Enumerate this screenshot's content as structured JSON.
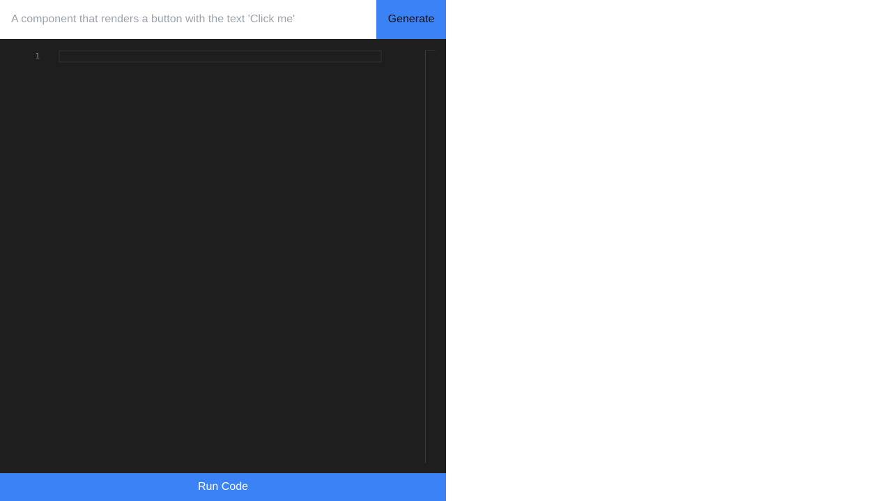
{
  "prompt": {
    "value": "",
    "placeholder": "A component that renders a button with the text 'Click me'",
    "generate_label": "Generate"
  },
  "editor": {
    "line_numbers": [
      "1"
    ],
    "code": ""
  },
  "run": {
    "label": "Run Code"
  },
  "colors": {
    "accent": "#3b82f6",
    "editor_background": "#1e1e1e",
    "preview_background": "#ffffff"
  }
}
